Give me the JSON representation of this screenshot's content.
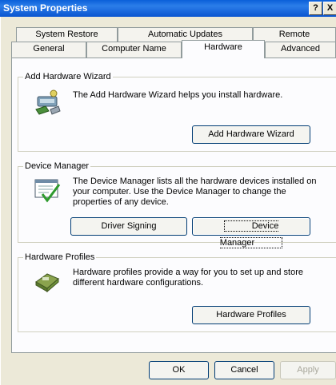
{
  "window": {
    "title": "System Properties",
    "help_glyph": "?",
    "close_glyph": "X"
  },
  "tabs_row1": [
    "System Restore",
    "Automatic Updates",
    "Remote"
  ],
  "tabs_row2": [
    "General",
    "Computer Name",
    "Hardware",
    "Advanced"
  ],
  "active_tab": "Hardware",
  "groups": {
    "wizard": {
      "legend": "Add Hardware Wizard",
      "description": "The Add Hardware Wizard helps you install hardware.",
      "button": "Add Hardware Wizard"
    },
    "device_manager": {
      "legend": "Device Manager",
      "description": "The Device Manager lists all the hardware devices installed on your computer. Use the Device Manager to change the properties of any device.",
      "button_signing": "Driver Signing",
      "button_manager": "Device Manager"
    },
    "profiles": {
      "legend": "Hardware Profiles",
      "description": "Hardware profiles provide a way for you to set up and store different hardware configurations.",
      "button": "Hardware Profiles"
    }
  },
  "footer": {
    "ok": "OK",
    "cancel": "Cancel",
    "apply": "Apply"
  }
}
